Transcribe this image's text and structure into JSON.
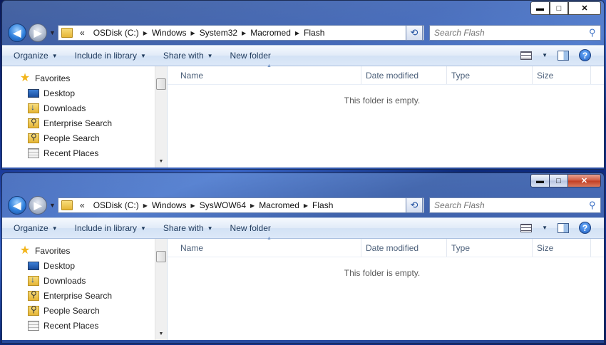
{
  "windows": [
    {
      "caption": {
        "minimize": "▬",
        "maximize": "□",
        "close": "✕"
      },
      "address": {
        "overflow": "«",
        "crumbs": [
          "OSDisk (C:)",
          "Windows",
          "System32",
          "Macromed",
          "Flash"
        ]
      },
      "search": {
        "placeholder": "Search Flash"
      },
      "toolbar": {
        "organize": "Organize",
        "include_in_library": "Include in library",
        "share_with": "Share with",
        "new_folder": "New folder"
      },
      "nav": {
        "favorites": "Favorites",
        "items": [
          "Desktop",
          "Downloads",
          "Enterprise Search",
          "People Search",
          "Recent Places"
        ]
      },
      "columns": {
        "name": "Name",
        "date_modified": "Date modified",
        "type": "Type",
        "size": "Size"
      },
      "empty_message": "This folder is empty."
    },
    {
      "caption": {
        "minimize": "▬",
        "maximize": "□",
        "close": "✕"
      },
      "address": {
        "overflow": "«",
        "crumbs": [
          "OSDisk (C:)",
          "Windows",
          "SysWOW64",
          "Macromed",
          "Flash"
        ]
      },
      "search": {
        "placeholder": "Search Flash"
      },
      "toolbar": {
        "organize": "Organize",
        "include_in_library": "Include in library",
        "share_with": "Share with",
        "new_folder": "New folder"
      },
      "nav": {
        "favorites": "Favorites",
        "items": [
          "Desktop",
          "Downloads",
          "Enterprise Search",
          "People Search",
          "Recent Places"
        ]
      },
      "columns": {
        "name": "Name",
        "date_modified": "Date modified",
        "type": "Type",
        "size": "Size"
      },
      "empty_message": "This folder is empty."
    }
  ],
  "icons": {
    "back": "back-arrow-icon",
    "forward": "forward-arrow-icon",
    "refresh": "refresh-icon",
    "search": "search-icon",
    "views": "views-icon",
    "preview": "preview-pane-icon",
    "help": "help-icon"
  },
  "colors": {
    "accent": "#1e395b",
    "desktop_bg": "#1b3b9a"
  }
}
